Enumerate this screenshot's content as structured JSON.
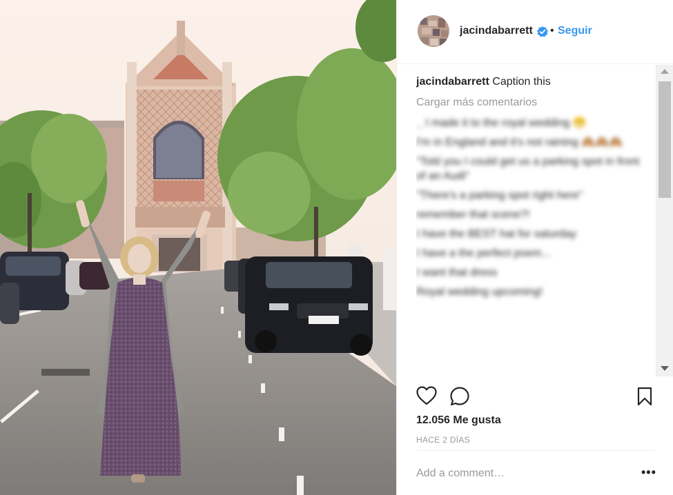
{
  "header": {
    "username": "jacindabarrett",
    "separator": "•",
    "follow_label": "Seguir"
  },
  "caption": {
    "username": "jacindabarrett",
    "text": "Caption this"
  },
  "load_more_label": "Cargar más comentarios",
  "blurred_comments": [
    {
      "user": "_",
      "text": "I made it to the royal wedding 😁"
    },
    {
      "user": "",
      "text": "I'm in England and it's not raining 🙈🙈🙈"
    },
    {
      "user": "",
      "text": "\"Told you I could get us a parking spot in front of an Audi\""
    },
    {
      "user": "",
      "text": "\"There's a parking spot right here\""
    },
    {
      "user": "",
      "text": "remember that scene?!",
      "mention": ""
    },
    {
      "user": "",
      "text": "I have the BEST hat for saturday"
    },
    {
      "user": "",
      "text": "I have a the perfect poem..."
    },
    {
      "user": "",
      "text": "I want that dress"
    },
    {
      "user": "",
      "text": "Royal wedding upcoming!"
    }
  ],
  "likes_text": "12.056 Me gusta",
  "time_ago": "HACE 2 DÍAS",
  "add_comment_placeholder": "Add a comment…",
  "more_label": "•••",
  "colors": {
    "link_blue": "#3897f0",
    "text": "#262626",
    "muted": "#999999"
  }
}
